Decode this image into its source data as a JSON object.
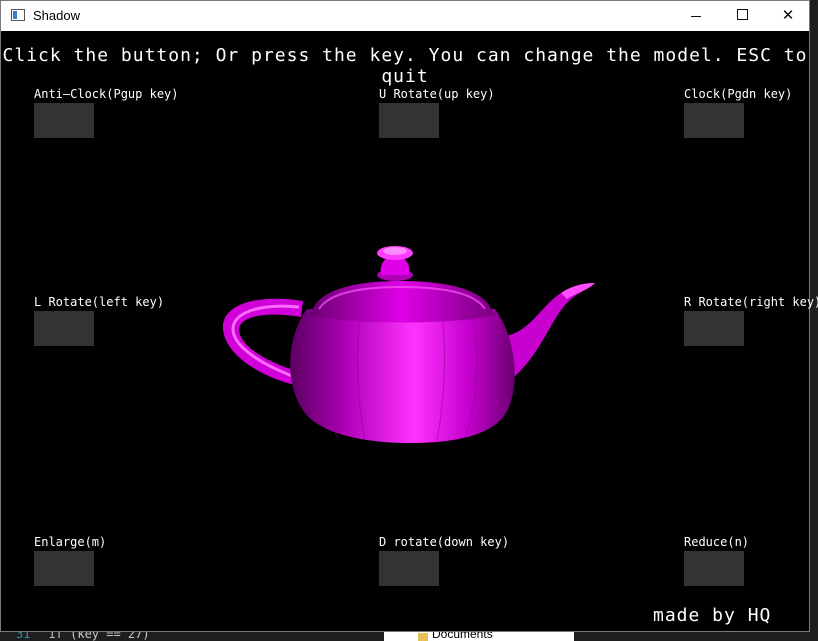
{
  "window": {
    "title": "Shadow",
    "controls": {
      "minimize": "—",
      "maximize": "☐",
      "close": "✕"
    }
  },
  "canvas": {
    "instruction": "Click the button; Or press the key. You can change the model. ESC to quit",
    "credit": "made by HQ",
    "model": {
      "name": "teapot-icon",
      "color": "#ff00ff"
    },
    "buttons": {
      "anti_clock": "Anti—Clock(Pgup key)",
      "up_rotate": "U Rotate(up key)",
      "clock": "Clock(Pgdn key)",
      "left_rotate": "L Rotate(left key)",
      "right_rotate": "R Rotate(right key)",
      "enlarge": "Enlarge(m)",
      "down_rotate": "D rotate(down key)",
      "reduce": "Reduce(n)"
    }
  },
  "background": {
    "code_line_number": "31",
    "code_snippet": "if (key == 27)",
    "explorer_item": "Documents"
  }
}
